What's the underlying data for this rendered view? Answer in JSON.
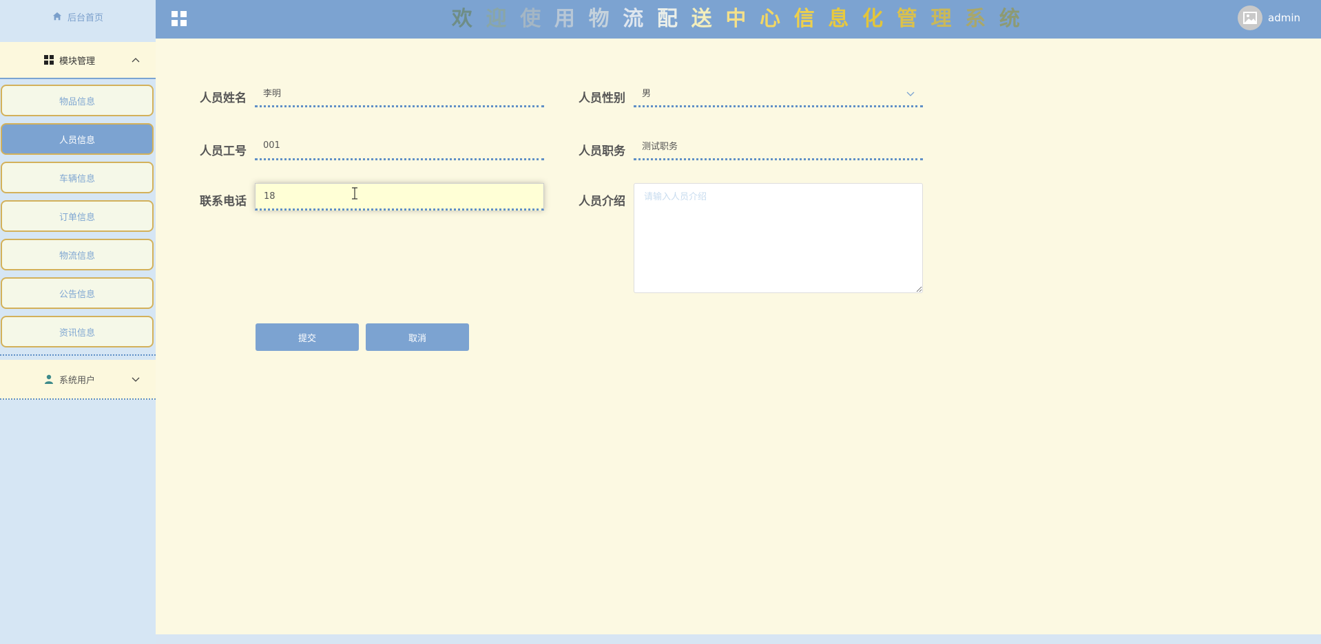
{
  "sidebar": {
    "home_label": "后台首页",
    "module_label": "模块管理",
    "items": [
      {
        "label": "物品信息"
      },
      {
        "label": "人员信息"
      },
      {
        "label": "车辆信息"
      },
      {
        "label": "订单信息"
      },
      {
        "label": "物流信息"
      },
      {
        "label": "公告信息"
      },
      {
        "label": "资讯信息"
      }
    ],
    "active_item": "人员信息",
    "user_section_label": "系统用户"
  },
  "header": {
    "title_chars": [
      {
        "ch": "欢",
        "color": "#6e8d86"
      },
      {
        "ch": "迎",
        "color": "#8aa6a6"
      },
      {
        "ch": "使",
        "color": "#a4b6c4"
      },
      {
        "ch": "用",
        "color": "#b8c7d6"
      },
      {
        "ch": "物",
        "color": "#c5d2dc"
      },
      {
        "ch": "流",
        "color": "#dfe6ee"
      },
      {
        "ch": "配",
        "color": "#ebefe9"
      },
      {
        "ch": "送",
        "color": "#f3eebc"
      },
      {
        "ch": "中",
        "color": "#f4e08a"
      },
      {
        "ch": "心",
        "color": "#f2d763"
      },
      {
        "ch": "信",
        "color": "#eed04c"
      },
      {
        "ch": "息",
        "color": "#e8c93f"
      },
      {
        "ch": "化",
        "color": "#e3c53a"
      },
      {
        "ch": "管",
        "color": "#dcc14a"
      },
      {
        "ch": "理",
        "color": "#c9b85a"
      },
      {
        "ch": "系",
        "color": "#a9a76a"
      },
      {
        "ch": "统",
        "color": "#8d9a73"
      }
    ],
    "username": "admin"
  },
  "form": {
    "name_label": "人员姓名",
    "name_value": "李明",
    "gender_label": "人员性别",
    "gender_value": "男",
    "id_label": "人员工号",
    "id_value": "001",
    "duty_label": "人员职务",
    "duty_value": "测试职务",
    "phone_label": "联系电话",
    "phone_value": "18",
    "intro_label": "人员介绍",
    "intro_placeholder": "请输入人员介绍",
    "submit_label": "提交",
    "cancel_label": "取消"
  },
  "colors": {
    "accent": "#7ca3d1",
    "menu_border": "#d3b15a",
    "content_bg": "#fcf9e2"
  }
}
